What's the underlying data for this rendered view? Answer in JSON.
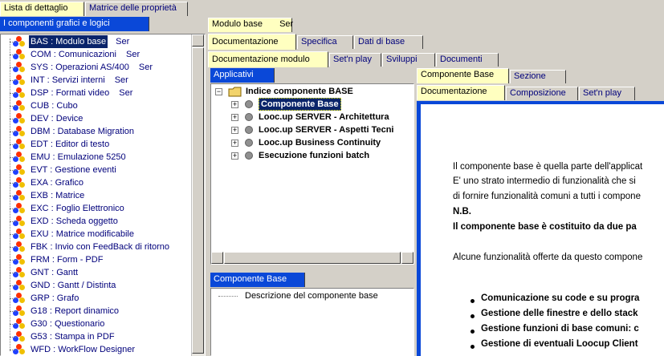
{
  "top_tabs": [
    "Lista di dettaglio",
    "Matrice delle proprietà"
  ],
  "left_header": "I componenti grafici e logici",
  "left_items": [
    {
      "code": "BAS : Modulo base",
      "suffix": "Ser"
    },
    {
      "code": "COM : Comunicazioni",
      "suffix": "Ser"
    },
    {
      "code": "SYS : Operazioni AS/400",
      "suffix": "Ser"
    },
    {
      "code": "INT : Servizi interni",
      "suffix": "Ser"
    },
    {
      "code": "DSP : Formati video",
      "suffix": "Ser"
    },
    {
      "code": "CUB : Cubo",
      "suffix": ""
    },
    {
      "code": "DEV : Device",
      "suffix": ""
    },
    {
      "code": "DBM : Database Migration",
      "suffix": ""
    },
    {
      "code": "EDT : Editor di testo",
      "suffix": ""
    },
    {
      "code": "EMU : Emulazione 5250",
      "suffix": ""
    },
    {
      "code": "EVT : Gestione eventi",
      "suffix": ""
    },
    {
      "code": "EXA : Grafico",
      "suffix": ""
    },
    {
      "code": "EXB : Matrice",
      "suffix": ""
    },
    {
      "code": "EXC : Foglio Elettronico",
      "suffix": ""
    },
    {
      "code": "EXD : Scheda oggetto",
      "suffix": ""
    },
    {
      "code": "EXU : Matrice modificabile",
      "suffix": ""
    },
    {
      "code": "FBK : Invio con FeedBack di ritorno",
      "suffix": ""
    },
    {
      "code": "FRM : Form - PDF",
      "suffix": ""
    },
    {
      "code": "GNT : Gantt",
      "suffix": ""
    },
    {
      "code": "GND : Gantt / Distinta",
      "suffix": ""
    },
    {
      "code": "GRP : Grafo",
      "suffix": ""
    },
    {
      "code": "G18 : Report dinamico",
      "suffix": ""
    },
    {
      "code": "G30 : Questionario",
      "suffix": ""
    },
    {
      "code": "G53 : Stampa in PDF",
      "suffix": ""
    },
    {
      "code": "WFD : WorkFlow Designer",
      "suffix": ""
    }
  ],
  "module": {
    "label": "Modulo base",
    "value": "Ser"
  },
  "tabs_row1": [
    "Documentazione",
    "Specifica",
    "Dati di base"
  ],
  "tabs_row2": [
    "Documentazione modulo",
    "Set'n play",
    "Sviluppi",
    "Documenti"
  ],
  "applicativi_header": "Applicativi",
  "tree_root": "Indice componente BASE",
  "tree_items": [
    "Componente Base",
    "Looc.up SERVER - Architettura",
    "Looc.up SERVER - Aspetti Tecni",
    "Looc.up Business Continuity",
    "Esecuzione funzioni batch"
  ],
  "comp_header": "Componente Base",
  "comp_desc": "Descrizione del componente base",
  "right_tabs1": [
    "Componente Base",
    "Sezione"
  ],
  "right_tabs2": [
    "Documentazione",
    "Composizione",
    "Set'n play"
  ],
  "doc_lines": [
    "Il componente base è quella parte dell'applicat",
    "E' uno strato intermedio di funzionalità che si",
    "di fornire funzionalità comuni a tutti i compone",
    "N.B.",
    "Il componente base è costituito da due pa",
    "Alcune funzionalità offerte da questo compone"
  ],
  "doc_bullets": [
    "Comunicazione su code e su progra",
    "Gestione delle finestre e dello stack",
    "Gestione funzioni di base comuni: c",
    "Gestione di eventuali Loocup Client"
  ],
  "colors": {
    "accent": "#0a48d8",
    "tab_active": "#ffffc0",
    "selection": "#0a246a",
    "link": "#00007b"
  }
}
